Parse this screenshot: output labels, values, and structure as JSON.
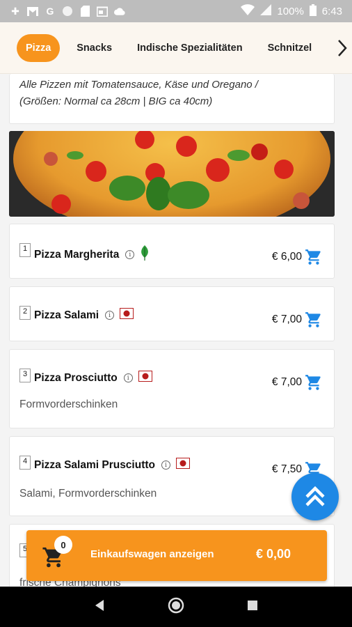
{
  "status_bar": {
    "battery_text": "100%",
    "time": "6:43",
    "icons": [
      "plus-icon",
      "gmail-icon",
      "google-icon",
      "circle-icon",
      "sd-card-icon",
      "calendar-icon",
      "cloud-icon",
      "wifi-icon",
      "signal-icon",
      "battery-icon"
    ]
  },
  "tabs": [
    {
      "label": "Pizza",
      "active": true
    },
    {
      "label": "Snacks",
      "active": false
    },
    {
      "label": "Indische Spezialitäten",
      "active": false
    },
    {
      "label": "Schnitzel",
      "active": false
    }
  ],
  "category_intro": {
    "line1": "Alle Pizzen mit Tomatensauce, Käse und Oregano /",
    "line2": "(Größen: Normal ca 28cm | BIG ca 40cm)"
  },
  "items": [
    {
      "number": "1",
      "name": "Pizza Margherita",
      "tag_icon": "vegetarian-leaf-icon",
      "price": "€ 6,00",
      "description": ""
    },
    {
      "number": "2",
      "name": "Pizza Salami",
      "tag_icon": "meat-icon",
      "price": "€ 7,00",
      "description": ""
    },
    {
      "number": "3",
      "name": "Pizza Prosciutto",
      "tag_icon": "meat-icon",
      "price": "€ 7,00",
      "description": "Formvorderschinken"
    },
    {
      "number": "4",
      "name": "Pizza Salami Prusciutto",
      "tag_icon": "meat-icon",
      "price": "€ 7,50",
      "description": "Salami, Formvorderschinken"
    },
    {
      "number": "5",
      "name": "",
      "tag_icon": "",
      "price": "",
      "description": "frische Champignons"
    }
  ],
  "cart": {
    "count": "0",
    "label": "Einkaufswagen anzeigen",
    "total": "€ 0,00"
  },
  "colors": {
    "accent": "#f7941d",
    "primary_blue": "#1e88e5",
    "vegetarian_green": "#2e7d32",
    "meat_red": "#b71c1c"
  }
}
